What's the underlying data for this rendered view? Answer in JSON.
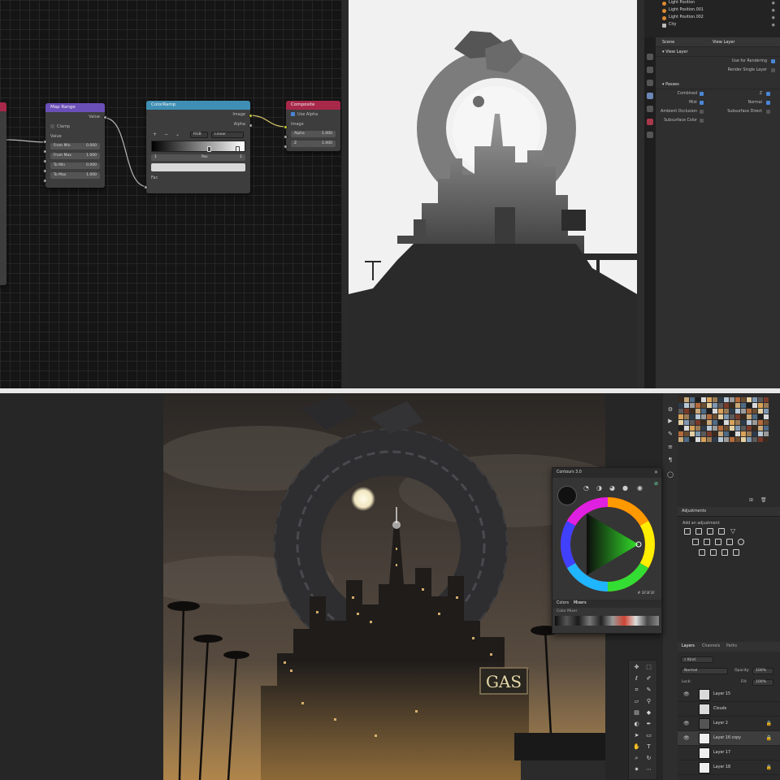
{
  "node_editor": {
    "map_range": {
      "title": "Map Range",
      "output": "Value",
      "clamp_label": "Clamp",
      "value_label": "Value",
      "fields": [
        {
          "label": "From Min",
          "value": "0.000"
        },
        {
          "label": "From Max",
          "value": "1.000"
        },
        {
          "label": "To Min",
          "value": "0.000"
        },
        {
          "label": "To Max",
          "value": "1.000"
        }
      ]
    },
    "color_ramp": {
      "title": "ColorRamp",
      "outputs": [
        "Image",
        "Alpha"
      ],
      "mode_left": "RGB",
      "mode_right": "Linear",
      "index": "1",
      "pos_label": "Pos",
      "pos_value": "1",
      "input": "Fac"
    },
    "composite": {
      "title": "Composite",
      "use_alpha": "Use Alpha",
      "inputs": [
        "Image"
      ],
      "alpha_label": "Alpha",
      "alpha_value": "1.000",
      "z_label": "Z",
      "z_value": "1.000"
    }
  },
  "outliner": {
    "items": [
      {
        "name": "Light Position"
      },
      {
        "name": "Light Position.001"
      },
      {
        "name": "Light Position.002"
      },
      {
        "name": "City"
      }
    ]
  },
  "properties": {
    "header_left": "Scene",
    "header_right": "View Layer",
    "view_layer_panel": "View Layer",
    "use_for_rendering": "Use for Rendering",
    "render_single_layer": "Render Single Layer",
    "passes_panel": "Passes",
    "passes": [
      {
        "left": "Combined",
        "right": "Z"
      },
      {
        "left": "Mist",
        "right": "Normal"
      },
      {
        "left": "Ambient Occlusion",
        "right": "Subsurface Direct"
      },
      {
        "left": "Subsurface Color",
        "right": ""
      }
    ]
  },
  "canvas": {
    "sign_text": "GAS"
  },
  "color_panel": {
    "title": "Contours 3.0",
    "tab_left": "Colors",
    "tab_active": "Mixers",
    "hex_value": "# 3F3F3F",
    "swatch_label": "Color Mixer"
  },
  "adjustments": {
    "title": "Adjustments",
    "subtitle": "Add an adjustment"
  },
  "layers_panel": {
    "tabs": [
      "Layers",
      "Channels",
      "Paths"
    ],
    "kind_filter": "Kind",
    "blend_mode": "Normal",
    "opacity_label": "Opacity:",
    "opacity_value": "100%",
    "lock_label": "Lock:",
    "fill_label": "Fill:",
    "fill_value": "100%",
    "layers": [
      {
        "name": "Layer 15"
      },
      {
        "name": "Clouds"
      },
      {
        "name": "Layer 2"
      },
      {
        "name": "Layer 16 copy"
      },
      {
        "name": "Layer 17"
      },
      {
        "name": "Layer 18"
      }
    ]
  },
  "colors": {
    "map_range_header": "#6b4fb8",
    "color_ramp_header": "#3f8fb4",
    "composite_header": "#a8284a",
    "selection_blue": "#4a86d6"
  }
}
